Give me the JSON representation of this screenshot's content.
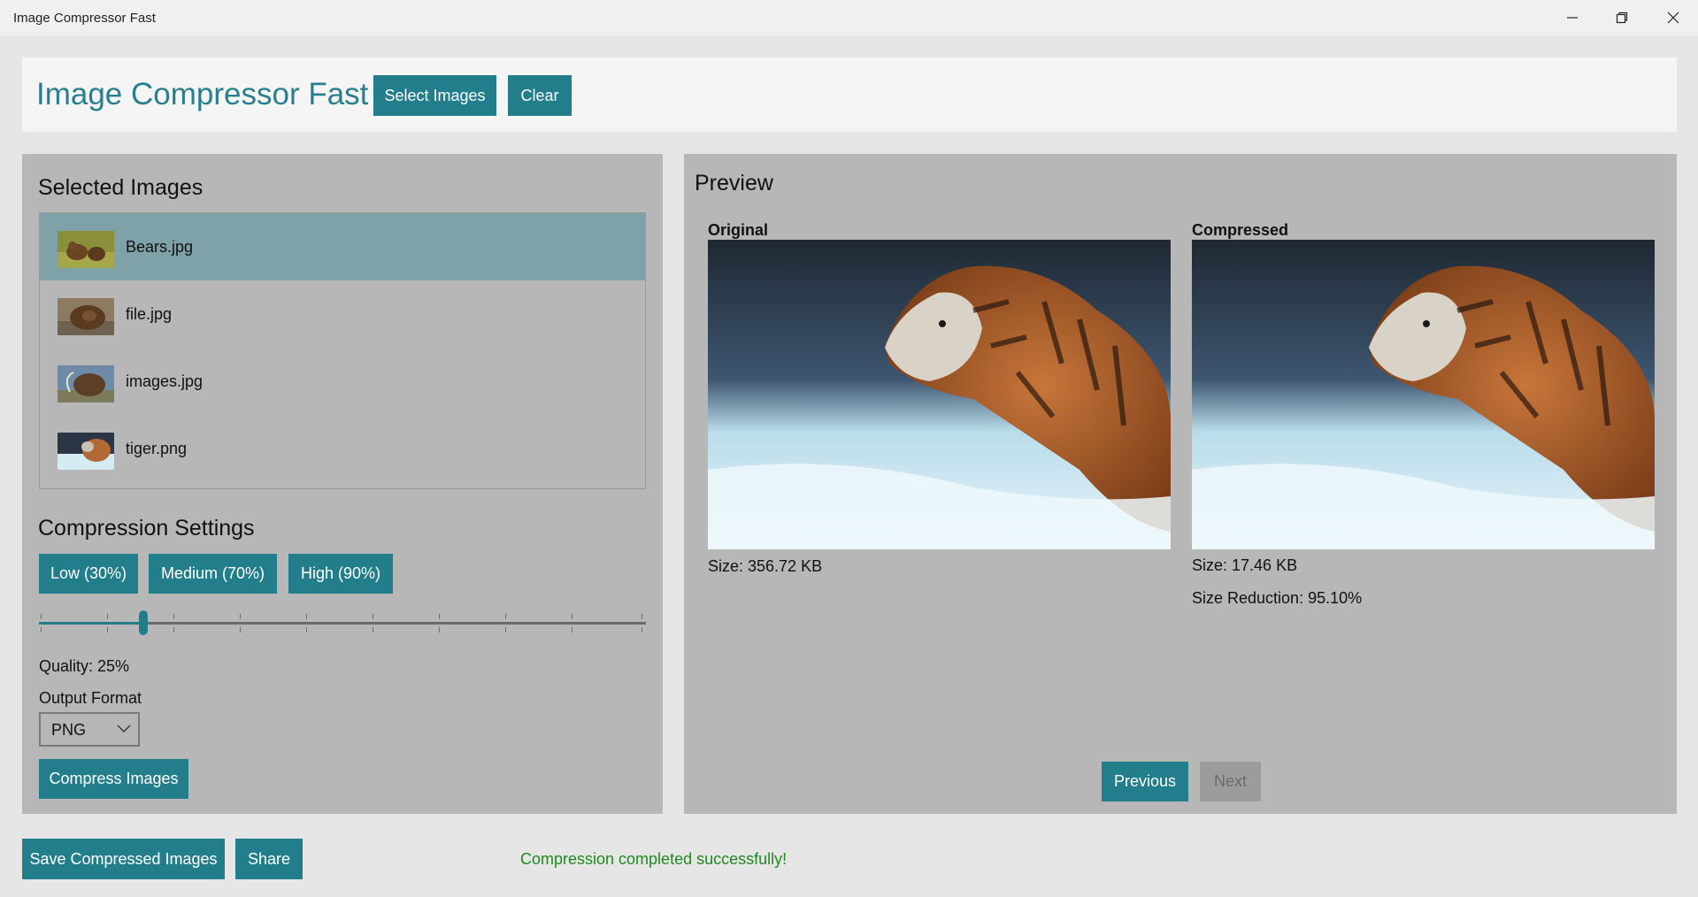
{
  "window": {
    "title": "Image Compressor Fast"
  },
  "header": {
    "brand": "Image Compressor Fast",
    "select_images_label": "Select Images",
    "clear_label": "Clear"
  },
  "selected_images": {
    "title": "Selected Images",
    "items": [
      {
        "name": "Bears.jpg",
        "selected": true
      },
      {
        "name": "file.jpg",
        "selected": false
      },
      {
        "name": "images.jpg",
        "selected": false
      },
      {
        "name": "tiger.png",
        "selected": false
      }
    ]
  },
  "compression": {
    "title": "Compression Settings",
    "presets": [
      "Low (30%)",
      "Medium (70%)",
      "High (90%)"
    ],
    "quality_value": 25,
    "quality_text": "Quality: 25%",
    "output_format_label": "Output Format",
    "output_format_value": "PNG",
    "compress_label": "Compress Images"
  },
  "preview": {
    "title": "Preview",
    "original_label": "Original",
    "compressed_label": "Compressed",
    "original_size": "Size: 356.72 KB",
    "compressed_size": "Size: 17.46 KB",
    "size_reduction": "Size Reduction: 95.10%",
    "previous_label": "Previous",
    "next_label": "Next"
  },
  "footer": {
    "save_label": "Save Compressed Images",
    "share_label": "Share",
    "status_text": "Compression completed successfully!"
  },
  "colors": {
    "accent": "#227e8b",
    "brand_text": "#2a7f8e",
    "selected_row": "#7ea2a7",
    "panel_bg": "#b7b7b7",
    "status_green": "#1e8a1e"
  }
}
